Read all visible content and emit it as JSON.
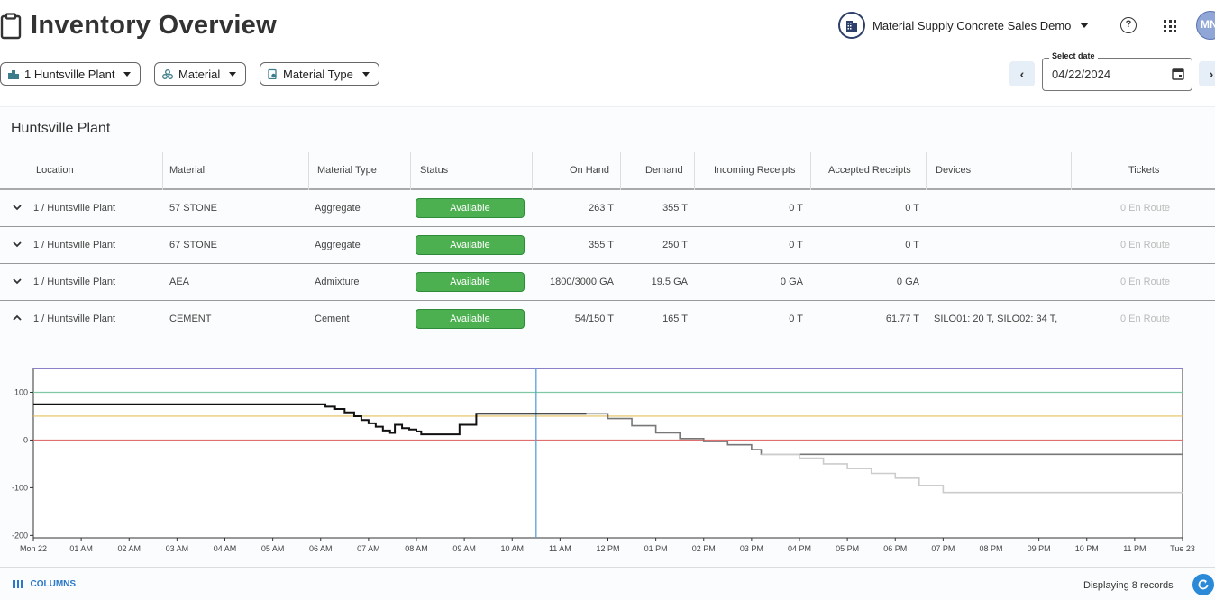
{
  "header": {
    "title": "Inventory Overview",
    "company": "Material Supply Concrete Sales Demo",
    "avatar_initials": "MN",
    "help_glyph": "?"
  },
  "filters": {
    "plant": "1 Huntsville Plant",
    "material": "Material",
    "material_type": "Material Type"
  },
  "date": {
    "label": "Select date",
    "value": "04/22/2024",
    "prev_glyph": "‹",
    "next_glyph": "›"
  },
  "panel": {
    "title": "Huntsville Plant"
  },
  "table": {
    "columns": [
      "Location",
      "Material",
      "Material Type",
      "Status",
      "On Hand",
      "Demand",
      "Incoming Receipts",
      "Accepted Receipts",
      "Devices",
      "Tickets"
    ],
    "rows": [
      {
        "location": "1 / Huntsville Plant",
        "material": "57 STONE",
        "type": "Aggregate",
        "status": "Available",
        "on_hand": "263 T",
        "demand": "355 T",
        "incoming": "0 T",
        "accepted": "0 T",
        "devices": "",
        "tickets": "0 En Route",
        "expanded": false
      },
      {
        "location": "1 / Huntsville Plant",
        "material": "67 STONE",
        "type": "Aggregate",
        "status": "Available",
        "on_hand": "355 T",
        "demand": "250 T",
        "incoming": "0 T",
        "accepted": "0 T",
        "devices": "",
        "tickets": "0 En Route",
        "expanded": false
      },
      {
        "location": "1 / Huntsville Plant",
        "material": "AEA",
        "type": "Admixture",
        "status": "Available",
        "on_hand": "1800/3000 GA",
        "demand": "19.5 GA",
        "incoming": "0 GA",
        "accepted": "0 GA",
        "devices": "",
        "tickets": "0 En Route",
        "expanded": false
      },
      {
        "location": "1 / Huntsville Plant",
        "material": "CEMENT",
        "type": "Cement",
        "status": "Available",
        "on_hand": "54/150 T",
        "demand": "165 T",
        "incoming": "0 T",
        "accepted": "61.77 T",
        "devices": "SILO01: 20 T, SILO02: 34 T,",
        "tickets": "0 En Route",
        "expanded": true
      }
    ]
  },
  "chart_data": {
    "type": "line",
    "title": "",
    "xlabel": "",
    "ylabel": "",
    "x_ticks": [
      "Mon 22",
      "01 AM",
      "02 AM",
      "03 AM",
      "04 AM",
      "05 AM",
      "06 AM",
      "07 AM",
      "08 AM",
      "09 AM",
      "10 AM",
      "11 AM",
      "12 PM",
      "01 PM",
      "02 PM",
      "03 PM",
      "04 PM",
      "05 PM",
      "06 PM",
      "07 PM",
      "08 PM",
      "09 PM",
      "10 PM",
      "11 PM",
      "Tue 23"
    ],
    "y_ticks": [
      100,
      0,
      -100,
      -200
    ],
    "xlim": [
      0,
      24
    ],
    "ylim": [
      -205,
      150
    ],
    "grid": false,
    "current_time_hour": 10.5,
    "reference_lines": [
      {
        "value": 150,
        "color": "#8a7fc9"
      },
      {
        "value": 100,
        "color": "#7ec8a4"
      },
      {
        "value": 50,
        "color": "#e3c15a"
      },
      {
        "value": 0,
        "color": "#e07070"
      }
    ],
    "series": [
      {
        "color": "#111111",
        "step": true,
        "values": [
          [
            0,
            75
          ],
          [
            5.95,
            75
          ],
          [
            6.1,
            70
          ],
          [
            6.3,
            65
          ],
          [
            6.5,
            58
          ],
          [
            6.7,
            50
          ],
          [
            6.85,
            42
          ],
          [
            7.0,
            35
          ],
          [
            7.15,
            28
          ],
          [
            7.3,
            20
          ],
          [
            7.45,
            15
          ],
          [
            7.55,
            32
          ],
          [
            7.7,
            25
          ],
          [
            7.85,
            22
          ],
          [
            8.0,
            18
          ],
          [
            8.1,
            12
          ],
          [
            8.9,
            12
          ],
          [
            8.9,
            32
          ],
          [
            9.25,
            32
          ],
          [
            9.25,
            55
          ],
          [
            11.55,
            55
          ]
        ]
      },
      {
        "color": "#777777",
        "step": true,
        "values": [
          [
            11.55,
            55
          ],
          [
            12.0,
            45
          ],
          [
            12.5,
            30
          ],
          [
            13.0,
            15
          ],
          [
            13.5,
            3
          ],
          [
            14.0,
            -3
          ],
          [
            14.5,
            -10
          ],
          [
            15.0,
            -20
          ],
          [
            15.2,
            -30
          ],
          [
            24,
            -30
          ]
        ]
      },
      {
        "color": "#cccccc",
        "step": true,
        "values": [
          [
            15.2,
            -30
          ],
          [
            16.0,
            -38
          ],
          [
            16.5,
            -50
          ],
          [
            17.0,
            -60
          ],
          [
            17.5,
            -70
          ],
          [
            18.0,
            -80
          ],
          [
            18.5,
            -95
          ],
          [
            19.0,
            -110
          ],
          [
            24,
            -110
          ]
        ]
      }
    ]
  },
  "footer": {
    "columns_label": "COLUMNS",
    "records_label": "Displaying 8 records"
  }
}
